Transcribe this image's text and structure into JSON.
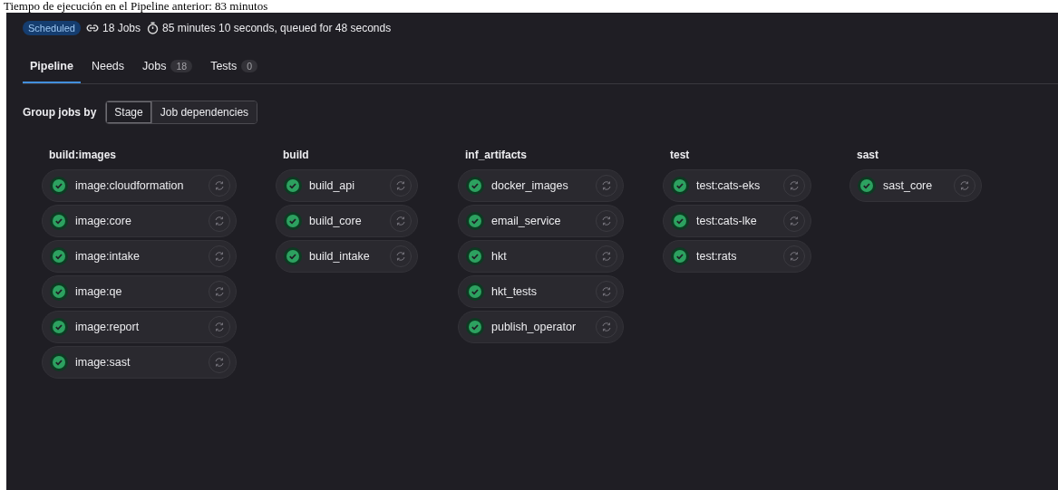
{
  "caption": "Tiempo de ejecución en el Pipeline anterior: 83 minutos",
  "header": {
    "badge": "Scheduled",
    "jobs": "18 Jobs",
    "duration": "85 minutes 10 seconds, queued for 48 seconds"
  },
  "tabs": [
    {
      "label": "Pipeline",
      "selected": true
    },
    {
      "label": "Needs",
      "selected": false
    },
    {
      "label": "Jobs",
      "count": "18",
      "selected": false
    },
    {
      "label": "Tests",
      "count": "0",
      "selected": false
    }
  ],
  "group_by": {
    "label": "Group jobs by",
    "options": [
      {
        "label": "Stage",
        "selected": true
      },
      {
        "label": "Job dependencies",
        "selected": false
      }
    ]
  },
  "stages": [
    {
      "name": "build:images",
      "jobs": [
        {
          "name": "image:cloudformation",
          "passed": true
        },
        {
          "name": "image:core",
          "passed": true
        },
        {
          "name": "image:intake",
          "passed": true
        },
        {
          "name": "image:qe",
          "passed": true
        },
        {
          "name": "image:report",
          "passed": true
        },
        {
          "name": "image:sast",
          "passed": true
        }
      ]
    },
    {
      "name": "build",
      "jobs": [
        {
          "name": "build_api",
          "passed": true
        },
        {
          "name": "build_core",
          "passed": true
        },
        {
          "name": "build_intake",
          "passed": true
        }
      ]
    },
    {
      "name": "inf_artifacts",
      "jobs": [
        {
          "name": "docker_images",
          "passed": true
        },
        {
          "name": "email_service",
          "passed": true
        },
        {
          "name": "hkt",
          "passed": true
        },
        {
          "name": "hkt_tests",
          "passed": true
        },
        {
          "name": "publish_operator",
          "passed": true
        }
      ]
    },
    {
      "name": "test",
      "jobs": [
        {
          "name": "test:cats-eks",
          "passed": true
        },
        {
          "name": "test:cats-lke",
          "passed": true
        },
        {
          "name": "test:rats",
          "passed": true
        }
      ]
    },
    {
      "name": "sast",
      "jobs": [
        {
          "name": "sast_core",
          "passed": true
        }
      ]
    }
  ]
}
